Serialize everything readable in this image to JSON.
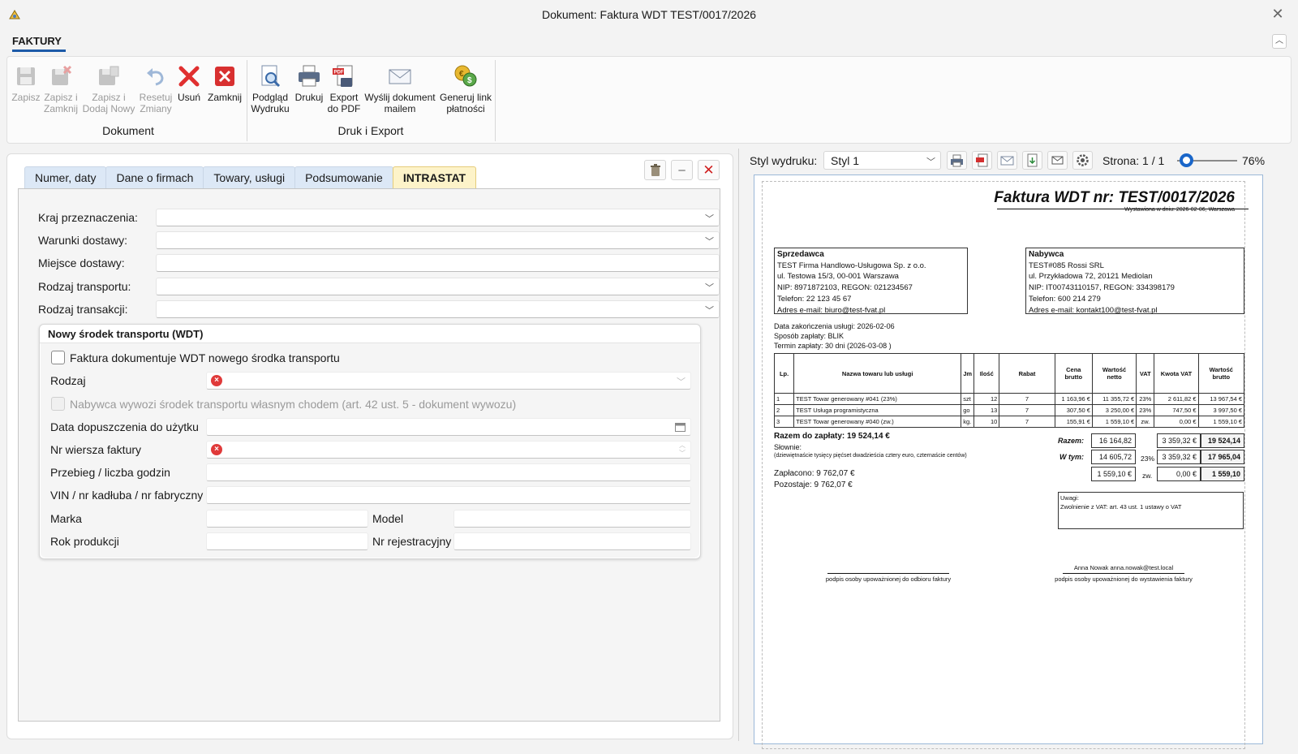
{
  "window": {
    "title": "Dokument: Faktura WDT TEST/0017/2026"
  },
  "ribbon": {
    "tab": "FAKTURY",
    "buttons": {
      "zapisz": "Zapisz",
      "zapisz_zamknij_1": "Zapisz i",
      "zapisz_zamknij_2": "Zamknij",
      "zapisz_dodaj_1": "Zapisz i",
      "zapisz_dodaj_2": "Dodaj Nowy",
      "resetuj_1": "Resetuj",
      "resetuj_2": "Zmiany",
      "usun": "Usuń",
      "zamknij": "Zamknij",
      "podglad_1": "Podgląd",
      "podglad_2": "Wydruku",
      "drukuj": "Drukuj",
      "export_1": "Export",
      "export_2": "do PDF",
      "wyslij_1": "Wyślij dokument",
      "wyslij_2": "mailem",
      "link_1": "Generuj link",
      "link_2": "płatności"
    },
    "groups": {
      "dokument": "Dokument",
      "druk": "Druk i Export"
    }
  },
  "tabs": [
    "Numer, daty",
    "Dane o firmach",
    "Towary, usługi",
    "Podsumowanie",
    "INTRASTAT"
  ],
  "form": {
    "kraj": "Kraj przeznaczenia:",
    "warunki": "Warunki dostawy:",
    "miejsce": "Miejsce dostawy:",
    "transport": "Rodzaj transportu:",
    "transakcja": "Rodzaj transakcji:"
  },
  "wdt": {
    "title": "Nowy środek transportu (WDT)",
    "faktura_chk": "Faktura dokumentuje WDT nowego środka transportu",
    "rodzaj": "Rodzaj",
    "nabywca_chk": "Nabywca wywozi środek transportu własnym chodem (art. 42 ust. 5 - dokument wywozu)",
    "data": "Data dopuszczenia do użytku",
    "nr_wiersza": "Nr wiersza faktury",
    "przebieg": "Przebieg / liczba godzin",
    "vin": "VIN / nr kadłuba / nr fabryczny",
    "marka": "Marka",
    "model": "Model",
    "rok": "Rok produkcji",
    "nr_rej": "Nr rejestracyjny"
  },
  "preview": {
    "style_label": "Styl wydruku:",
    "style_value": "Styl 1",
    "page": "Strona: 1 / 1",
    "zoom_percent": 76,
    "zoom_label": "76%"
  },
  "invoice": {
    "title": "Faktura WDT nr: TEST/0017/2026",
    "issued": "Wystawiona w dniu: 2026-02-06, Warszawa",
    "seller": {
      "header": "Sprzedawca",
      "name": "TEST Firma Handlowo-Usługowa Sp. z o.o.",
      "address": "ul. Testowa 15/3, 00-001 Warszawa",
      "nip": "NIP: 8971872103, REGON: 021234567",
      "phone": "Telefon: 22 123 45 67",
      "email": "Adres e-mail: biuro@test-fvat.pl"
    },
    "buyer": {
      "header": "Nabywca",
      "name": "TEST#085 Rossi SRL",
      "address": "ul. Przykładowa 72, 20121 Mediolan",
      "nip": "NIP: IT00743110157, REGON: 334398179",
      "phone": "Telefon: 600 214 279",
      "email": "Adres e-mail: kontakt100@test-fvat.pl"
    },
    "dates": {
      "service": "Data zakończenia usługi: 2026-02-06",
      "payment": "Sposób zapłaty: BLIK",
      "term": "Termin zapłaty: 30 dni (2026-03-08 )"
    },
    "columns": [
      "Lp.",
      "Nazwa towaru lub usługi",
      "Jm",
      "Ilość",
      "Rabat",
      "Cena brutto",
      "Wartość netto",
      "VAT",
      "Kwota VAT",
      "Wartość brutto"
    ],
    "rows": [
      [
        "1",
        "TEST Towar generowany #041 (23%)",
        "szt",
        "12",
        "7",
        "1 163,96 €",
        "11 355,72 €",
        "23%",
        "2 611,82 €",
        "13 967,54 €"
      ],
      [
        "2",
        "TEST Usługa programistyczna",
        "go",
        "13",
        "7",
        "307,50 €",
        "3 250,00 €",
        "23%",
        "747,50 €",
        "3 997,50 €"
      ],
      [
        "3",
        "TEST Towar generowany #040 (zw.)",
        "kg.",
        "10",
        "7",
        "155,91 €",
        "1 559,10 €",
        "zw.",
        "0,00 €",
        "1 559,10 €"
      ]
    ],
    "razem": "Razem do zapłaty: 19 524,14 €",
    "slownie": "Słownie:",
    "slownie_text": "(dziewiętnaście tysięcy pięćset dwadzieścia cztery euro, czternaście centów)",
    "zaplacono": "Zapłacono: 9 762,07 €",
    "pozostaje": "Pozostaje: 9 762,07 €",
    "summary": {
      "razem_lbl": "Razem:",
      "wtym_lbl": "W tym:",
      "netto_total": "16 164,82",
      "vat_total": "3 359,32 €",
      "brutto_total": "19 524,14",
      "netto_23": "14 605,72",
      "rate_23": "23%",
      "vat_23": "3 359,32 €",
      "brutto_23": "17 965,04",
      "netto_zw": "1 559,10 €",
      "rate_zw": "zw.",
      "vat_zw": "0,00 €",
      "brutto_zw": "1 559,10"
    },
    "uwagi_title": "Uwagi:",
    "uwagi_text": "Zwolnienie z VAT: art. 43 ust. 1 ustawy o VAT",
    "sign_receiver": "podpis osoby upoważnionej do odbioru faktury",
    "sign_issuer_name": "Anna Nowak anna.nowak@test.local",
    "sign_issuer": "podpis osoby upoważnionej do wystawienia faktury"
  }
}
